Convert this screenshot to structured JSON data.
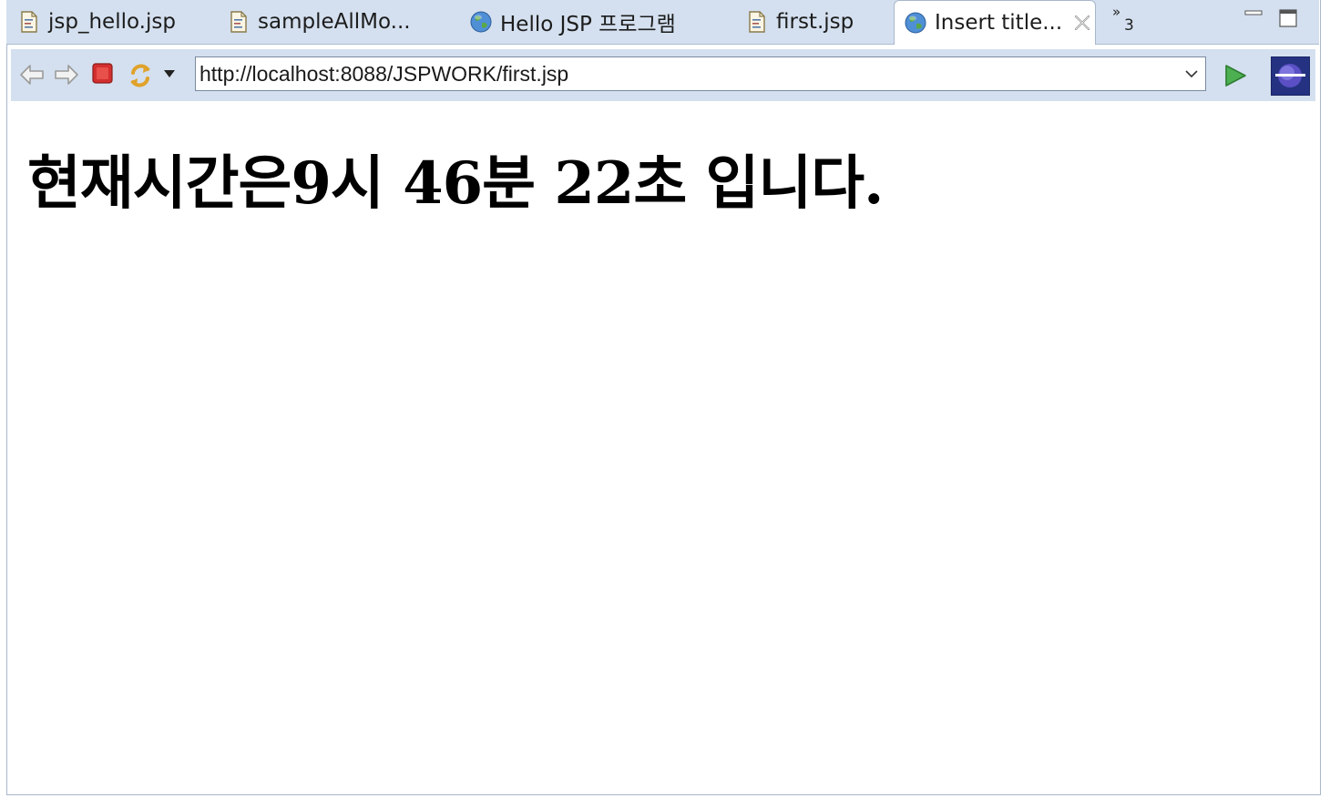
{
  "tabs": [
    {
      "label": "jsp_hello.jsp",
      "icon": "jsp-file-icon",
      "active": false
    },
    {
      "label": "sampleAllMo...",
      "icon": "jsp-file-icon",
      "active": false
    },
    {
      "label": "Hello JSP 프로그램",
      "icon": "globe-icon",
      "active": false
    },
    {
      "label": "first.jsp",
      "icon": "jsp-file-icon",
      "active": false
    },
    {
      "label": "Insert title...",
      "icon": "globe-icon",
      "active": true
    }
  ],
  "overflow": {
    "chevron": "»",
    "count": "3"
  },
  "toolbar": {
    "back_icon": "back-arrow-icon",
    "forward_icon": "forward-arrow-icon",
    "stop_icon": "stop-icon",
    "refresh_icon": "refresh-icon",
    "go_icon": "go-icon",
    "url": "http://localhost:8088/JSPWORK/first.jsp"
  },
  "page": {
    "text": "현재시간은9시 46분 22초 입니다."
  },
  "colors": {
    "chrome": "#d4e0ef",
    "go_green": "#3f9a3a",
    "stop_red": "#c62828"
  }
}
